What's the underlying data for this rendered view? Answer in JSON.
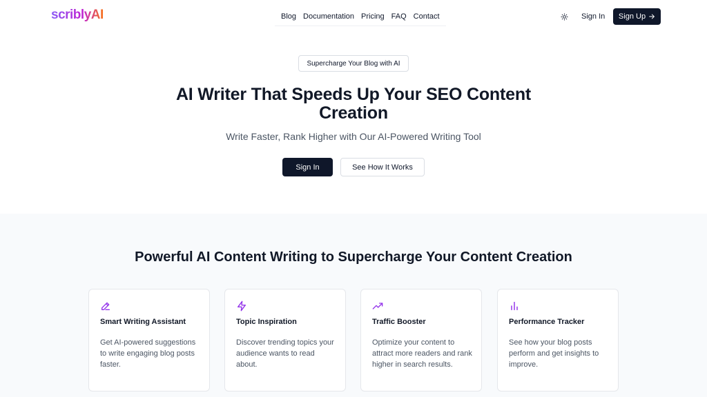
{
  "header": {
    "logo": "scriblyAI",
    "nav": [
      "Blog",
      "Documentation",
      "Pricing",
      "FAQ",
      "Contact"
    ],
    "theme_icon": "sun-icon",
    "sign_in": "Sign In",
    "sign_up": "Sign Up",
    "sign_up_icon": "arrow-right-icon"
  },
  "hero": {
    "badge": "Supercharge Your Blog with AI",
    "title": "AI Writer That Speeds Up Your SEO Content Creation",
    "subtitle": "Write Faster, Rank Higher with Our AI-Powered Writing Tool",
    "primary_cta": "Sign In",
    "secondary_cta": "See How It Works"
  },
  "features": {
    "title": "Powerful AI Content Writing to Supercharge Your Content Creation",
    "accent_color": "#9333ea",
    "cards": [
      {
        "icon": "pencil-icon",
        "title": "Smart Writing Assistant",
        "desc": "Get AI-powered suggestions to write engaging blog posts faster."
      },
      {
        "icon": "lightning-icon",
        "title": "Topic Inspiration",
        "desc": "Discover trending topics your audience wants to read about."
      },
      {
        "icon": "trending-up-icon",
        "title": "Traffic Booster",
        "desc": "Optimize your content to attract more readers and rank higher in search results."
      },
      {
        "icon": "bar-chart-icon",
        "title": "Performance Tracker",
        "desc": "See how your blog posts perform and get insights to improve."
      }
    ]
  }
}
